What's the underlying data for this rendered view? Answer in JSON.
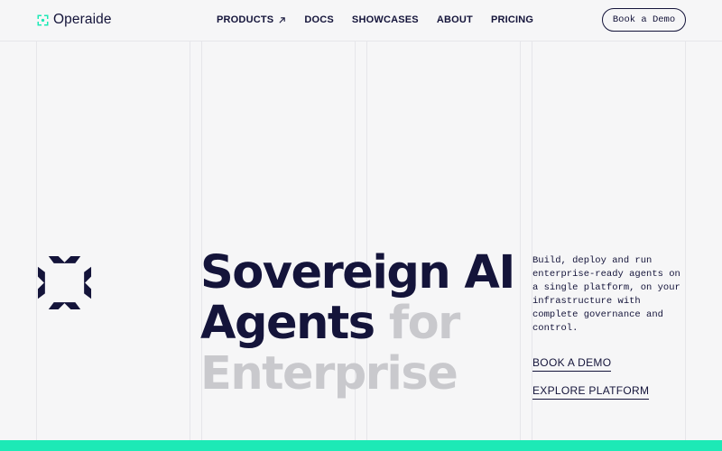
{
  "brand": {
    "name": "Operaide",
    "accent_color": "#1de9b6",
    "logo_icon": "operaide-logo-icon"
  },
  "nav": {
    "items": [
      {
        "label": "PRODUCTS",
        "icon": "arrow-up-right-icon"
      },
      {
        "label": "DOCS"
      },
      {
        "label": "SHOWCASES"
      },
      {
        "label": "ABOUT"
      },
      {
        "label": "PRICING"
      }
    ]
  },
  "header": {
    "cta_label": "Book a Demo"
  },
  "hero": {
    "line1": "Sovereign AI",
    "line2_strong": "Agents",
    "line2_dim": "for",
    "line3": "Enterprise",
    "text_color": "#14143a",
    "dim_color": "#c9c9cd"
  },
  "description": "Build, deploy and run enterprise-ready agents on a single platform, on your infrastructure with complete governance and control.",
  "links": {
    "book_demo": "BOOK A DEMO",
    "explore": "EXPLORE PLATFORM"
  }
}
